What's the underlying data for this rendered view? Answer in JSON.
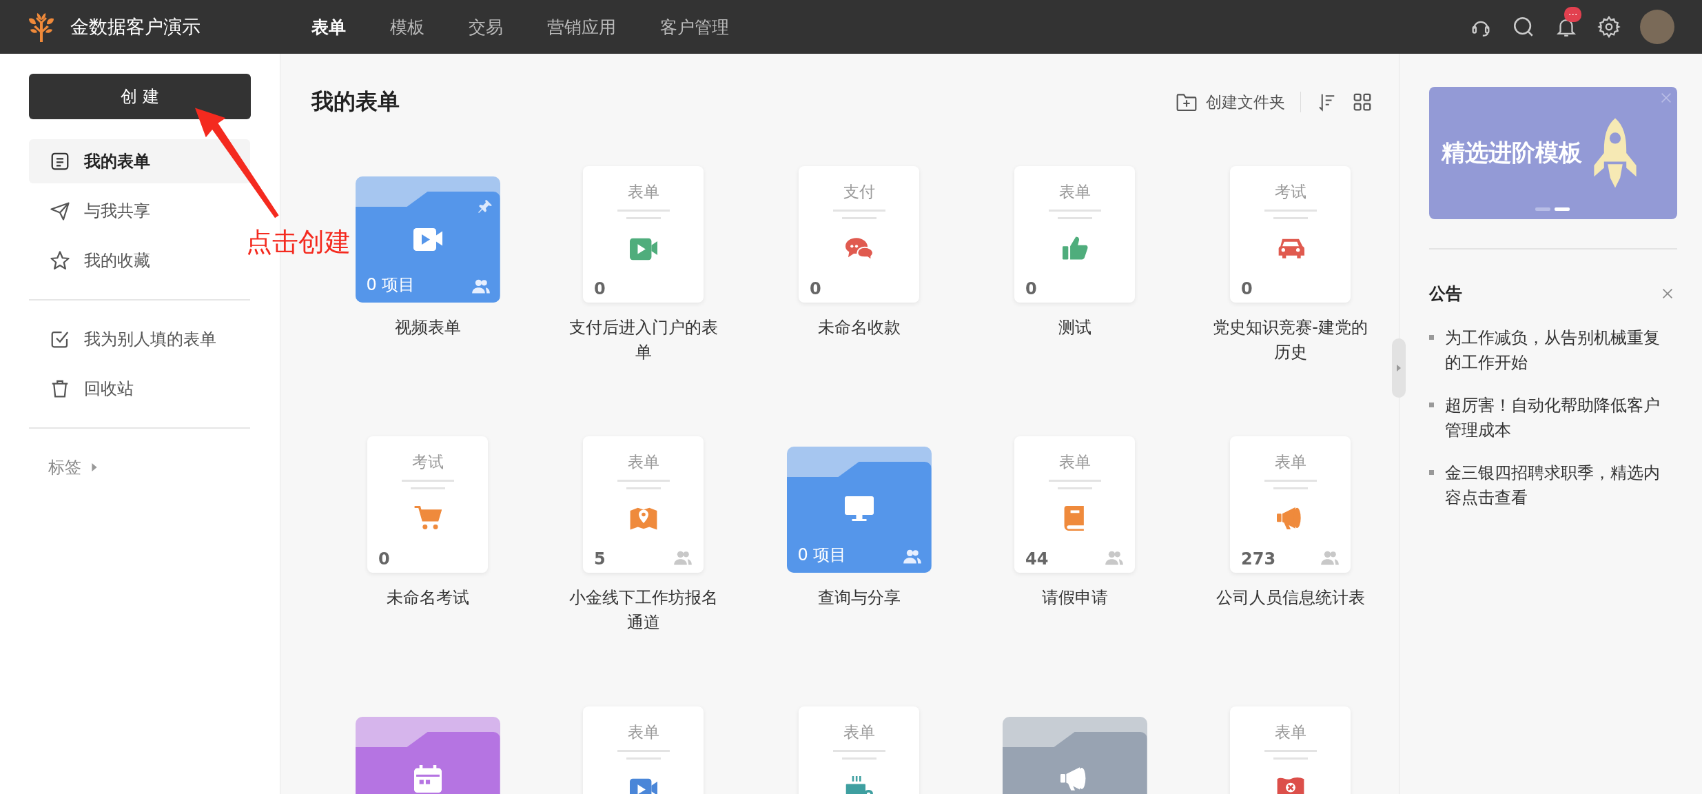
{
  "app": {
    "name": "金数据客户演示"
  },
  "nav": [
    {
      "label": "表单",
      "selected": true
    },
    {
      "label": "模板",
      "selected": false
    },
    {
      "label": "交易",
      "selected": false
    },
    {
      "label": "营销应用",
      "selected": false
    },
    {
      "label": "客户管理",
      "selected": false
    }
  ],
  "notification_badge": "···",
  "sidebar": {
    "create_button": "创 建",
    "groups": [
      [
        {
          "label": "我的表单",
          "selected": true
        },
        {
          "label": "与我共享",
          "selected": false
        },
        {
          "label": "我的收藏",
          "selected": false
        }
      ],
      [
        {
          "label": "我为别人填的表单",
          "selected": false
        },
        {
          "label": "回收站",
          "selected": false
        }
      ]
    ],
    "tags_label": "标签"
  },
  "annotation": {
    "text": "点击创建"
  },
  "main": {
    "title": "我的表单",
    "create_folder": "创建文件夹",
    "items": [
      {
        "kind": "folder",
        "color": "#5596ea",
        "count": "0 项目",
        "title": "视频表单",
        "pinned": true
      },
      {
        "kind": "form",
        "type": "表单",
        "color": "#4fad7c",
        "count": "0",
        "title": "支付后进入门户的表单",
        "shared": false
      },
      {
        "kind": "form",
        "type": "支付",
        "color": "#e05a4f",
        "count": "0",
        "title": "未命名收款",
        "shared": false
      },
      {
        "kind": "form",
        "type": "表单",
        "color": "#4fad7c",
        "count": "0",
        "title": "测试",
        "shared": false
      },
      {
        "kind": "form",
        "type": "考试",
        "color": "#e05a4f",
        "count": "0",
        "title": "党史知识竞赛-建党的历史",
        "shared": false
      },
      {
        "kind": "form",
        "type": "考试",
        "color": "#ef8a3c",
        "count": "0",
        "title": "未命名考试",
        "shared": false
      },
      {
        "kind": "form",
        "type": "表单",
        "color": "#ef8a3c",
        "count": "5",
        "title": "小金线下工作坊报名通道",
        "shared": true
      },
      {
        "kind": "folder",
        "color": "#5596ea",
        "count": "0 项目",
        "title": "查询与分享",
        "pinned": false
      },
      {
        "kind": "form",
        "type": "表单",
        "color": "#ef8a3c",
        "count": "44",
        "title": "请假申请",
        "shared": true
      },
      {
        "kind": "form",
        "type": "表单",
        "color": "#ef8a3c",
        "count": "273",
        "title": "公司人员信息统计表",
        "shared": true
      },
      {
        "kind": "folder",
        "color": "#b574e2",
        "pinned": false
      },
      {
        "kind": "form",
        "type": "表单",
        "color": "#4a86d8"
      },
      {
        "kind": "form",
        "type": "表单",
        "color": "#3e9fa0"
      },
      {
        "kind": "folder",
        "color": "#98a3b2",
        "pinned": false
      },
      {
        "kind": "form",
        "type": "表单",
        "color": "#dc4f4a"
      }
    ]
  },
  "right_panel": {
    "banner": {
      "text": "精选进阶模板"
    },
    "announcements": {
      "title": "公告",
      "items": [
        "为工作减负，从告别机械重复的工作开始",
        "超厉害！自动化帮助降低客户管理成本",
        "金三银四招聘求职季，精选内容点击查看"
      ]
    }
  }
}
